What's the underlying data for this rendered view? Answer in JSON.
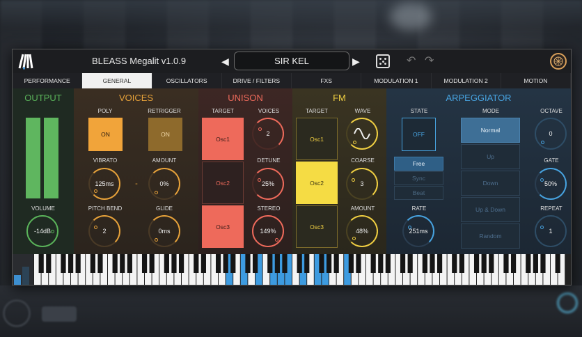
{
  "app": {
    "title": "BLEASS Megalit  v1.0.9",
    "preset": "SIR KEL"
  },
  "tabs": [
    {
      "label": "PERFORMANCE",
      "active": false
    },
    {
      "label": "GENERAL",
      "active": true
    },
    {
      "label": "OSCILLATORS",
      "active": false
    },
    {
      "label": "DRIVE / FILTERS",
      "active": false
    },
    {
      "label": "FXs",
      "active": false
    },
    {
      "label": "MODULATION 1",
      "active": false
    },
    {
      "label": "MODULATION 2",
      "active": false
    },
    {
      "label": "MOTION",
      "active": false
    }
  ],
  "output": {
    "title": "OUTPUT",
    "volume_label": "VOLUME",
    "volume_value": "-14dB"
  },
  "voices": {
    "title": "VOICES",
    "poly_label": "POLY",
    "poly_value": "ON",
    "retrigger_label": "RETRIGGER",
    "retrigger_value": "ON",
    "vibrato_label": "VIBRATO",
    "vibrato_value": "125ms",
    "dash": "-",
    "amount_label": "AMOUNT",
    "amount_value": "0%",
    "pitchbend_label": "PITCH BEND",
    "pitchbend_value": "2",
    "glide_label": "GLIDE",
    "glide_value": "0ms"
  },
  "unison": {
    "title": "UNISON",
    "target_label": "TARGET",
    "targets": [
      "Osc1",
      "Osc2",
      "Osc3"
    ],
    "voices_label": "VOICES",
    "voices_value": "2",
    "detune_label": "DETUNE",
    "detune_value": "25%",
    "stereo_label": "STEREO",
    "stereo_value": "149%"
  },
  "fm": {
    "title": "FM",
    "target_label": "TARGET",
    "targets": [
      "Osc1",
      "Osc2",
      "Osc3"
    ],
    "wave_label": "WAVE",
    "coarse_label": "COARSE",
    "coarse_value": "3",
    "amount_label": "AMOUNT",
    "amount_value": "48%"
  },
  "arp": {
    "title": "ARPEGGIATOR",
    "state_label": "STATE",
    "state_value": "OFF",
    "sync_modes": [
      "Free",
      "Sync",
      "Beat"
    ],
    "rate_label": "RATE",
    "rate_value": "251ms",
    "mode_label": "MODE",
    "modes": [
      "Normal",
      "Up",
      "Down",
      "Up & Down",
      "Random"
    ],
    "octave_label": "OCTAVE",
    "octave_value": "0",
    "gate_label": "GATE",
    "gate_value": "50%",
    "repeat_label": "REPEAT",
    "repeat_value": "1"
  },
  "colors": {
    "output": "#5ab35a",
    "voices": "#e7a23a",
    "unison": "#ee6a5b",
    "fm": "#f0cf42",
    "arp": "#47a3e0"
  },
  "keyboard": {
    "highlighted_keys": [
      "A4",
      "C5",
      "E5",
      "G5",
      "A5",
      "B5",
      "D6",
      "F6",
      "G6",
      "C7"
    ]
  }
}
